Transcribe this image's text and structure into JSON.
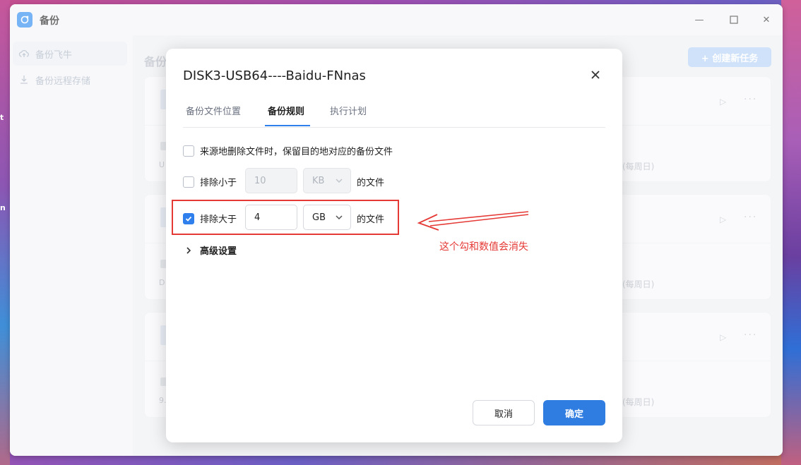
{
  "app": {
    "title": "备份",
    "accent": "#2f80ed"
  },
  "background": {
    "left_text_1": "t",
    "left_text_2": "n"
  },
  "window_controls": {
    "minimize": "—",
    "maximize": "☐",
    "close": "✕"
  },
  "sidebar": {
    "items": [
      {
        "label": "备份飞牛",
        "icon": "cloud-upload-icon"
      },
      {
        "label": "备份远程存储",
        "icon": "download-icon"
      }
    ]
  },
  "main": {
    "title": "备份",
    "create_button": "+ 创建新任务",
    "cards": [
      {
        "left_text": "U",
        "right_text": "(每周日)"
      },
      {
        "left_text": "D",
        "right_text": "(每周日)"
      },
      {
        "left_text": "9.",
        "right_text": "(每周日)"
      }
    ]
  },
  "dialog": {
    "title": "DISK3-USB64----Baidu-FNnas",
    "tabs": [
      "备份文件位置",
      "备份规则",
      "执行计划"
    ],
    "active_tab": "备份规则",
    "rule_keep_deleted": {
      "label": "来源地删除文件时，保留目的地对应的备份文件",
      "checked": false
    },
    "rule_exclude_smaller": {
      "label": "排除小于",
      "checked": false,
      "value": "10",
      "unit": "KB",
      "suffix": "的文件"
    },
    "rule_exclude_larger": {
      "label": "排除大于",
      "checked": true,
      "value": "4",
      "unit": "GB",
      "suffix": "的文件"
    },
    "advanced_label": "高级设置",
    "cancel_label": "取消",
    "ok_label": "确定"
  },
  "annotation": {
    "text": "这个勾和数值会消失",
    "color": "#e53935"
  }
}
